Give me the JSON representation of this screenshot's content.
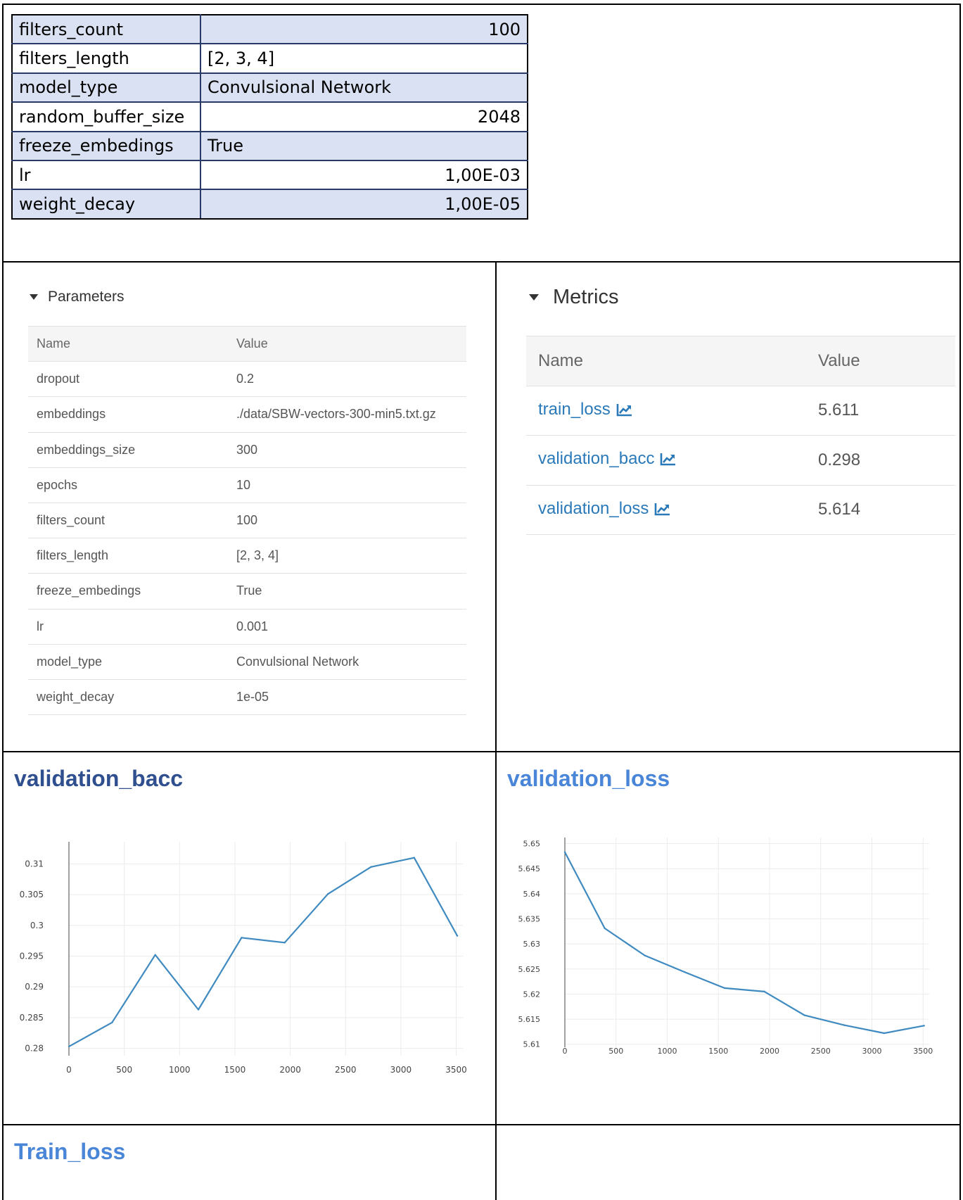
{
  "sheet": {
    "rows": [
      {
        "key": "filters_count",
        "value": "100"
      },
      {
        "key": "filters_length",
        "value": "[2, 3, 4]"
      },
      {
        "key": "model_type",
        "value": "Convulsional Network"
      },
      {
        "key": "random_buffer_size",
        "value": "2048"
      },
      {
        "key": "freeze_embedings",
        "value": "True"
      },
      {
        "key": "lr",
        "value": "1,00E-03"
      },
      {
        "key": "weight_decay",
        "value": "1,00E-05"
      }
    ]
  },
  "parameters": {
    "title": "Parameters",
    "col_name": "Name",
    "col_value": "Value",
    "rows": [
      {
        "name": "dropout",
        "value": "0.2"
      },
      {
        "name": "embeddings",
        "value": "./data/SBW-vectors-300-min5.txt.gz"
      },
      {
        "name": "embeddings_size",
        "value": "300"
      },
      {
        "name": "epochs",
        "value": "10"
      },
      {
        "name": "filters_count",
        "value": "100"
      },
      {
        "name": "filters_length",
        "value": "[2, 3, 4]"
      },
      {
        "name": "freeze_embedings",
        "value": "True"
      },
      {
        "name": "lr",
        "value": "0.001"
      },
      {
        "name": "model_type",
        "value": "Convulsional Network"
      },
      {
        "name": "weight_decay",
        "value": "1e-05"
      }
    ]
  },
  "metrics": {
    "title": "Metrics",
    "col_name": "Name",
    "col_value": "Value",
    "rows": [
      {
        "name": "train_loss",
        "value": "5.611"
      },
      {
        "name": "validation_bacc",
        "value": "0.298"
      },
      {
        "name": "validation_loss",
        "value": "5.614"
      }
    ]
  },
  "headings": {
    "validation_bacc": "validation_bacc",
    "validation_loss": "validation_loss",
    "train_loss": "Train_loss"
  },
  "colors": {
    "heading_dark": "#2f4f8f",
    "heading_light": "#4a86d8",
    "line": "#3f8ac0",
    "link": "#2a79b8"
  },
  "chart_data": [
    {
      "type": "line",
      "x": [
        0,
        390,
        780,
        1170,
        1560,
        1950,
        2340,
        2730,
        3120,
        3510
      ],
      "values": [
        0.2803,
        0.2842,
        0.2952,
        0.2863,
        0.298,
        0.2972,
        0.3051,
        0.3095,
        0.311,
        0.2983
      ],
      "xlim": [
        0,
        3560
      ],
      "ylim": [
        0.2788,
        0.3136
      ],
      "xticks": [
        "0",
        "500",
        "1000",
        "1500",
        "2000",
        "2500",
        "3000",
        "3500"
      ],
      "yticks": [
        "0.31",
        "0.305",
        "0.3",
        "0.295",
        "0.29",
        "0.285",
        "0.28"
      ],
      "grid": true
    },
    {
      "type": "line",
      "x": [
        0,
        390,
        780,
        1170,
        1560,
        1950,
        2340,
        2730,
        3120,
        3510
      ],
      "values": [
        5.6483,
        5.6331,
        5.6277,
        5.6244,
        5.6212,
        5.6205,
        5.6158,
        5.6138,
        5.6122,
        5.6137
      ],
      "xlim": [
        0,
        3560
      ],
      "ylim": [
        5.6094,
        5.6512
      ],
      "xticks": [
        "0",
        "500",
        "1000",
        "1500",
        "2000",
        "2500",
        "3000",
        "3500"
      ],
      "yticks": [
        "5.65",
        "5.645",
        "5.64",
        "5.635",
        "5.63",
        "5.625",
        "5.62",
        "5.615",
        "5.61"
      ],
      "grid": true
    }
  ]
}
